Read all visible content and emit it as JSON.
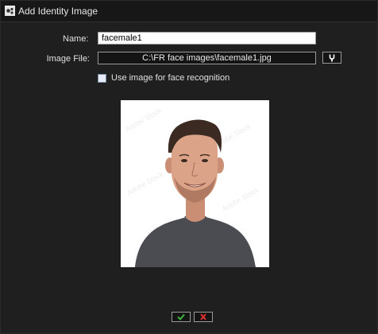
{
  "window": {
    "title": "Add Identity Image"
  },
  "form": {
    "name_label": "Name:",
    "name_value": "facemale1",
    "file_label": "Image File:",
    "file_value": "C:\\FR face images\\facemale1.jpg",
    "use_image_label": "Use image for face recognition",
    "use_image_checked": false
  },
  "icons": {
    "app": "app-icon",
    "browse": "tuning-fork-icon",
    "ok": "checkmark-icon",
    "cancel": "x-icon"
  },
  "colors": {
    "background": "#1f1f1f",
    "ok_icon": "#3cb43c",
    "cancel_icon": "#e03030"
  }
}
